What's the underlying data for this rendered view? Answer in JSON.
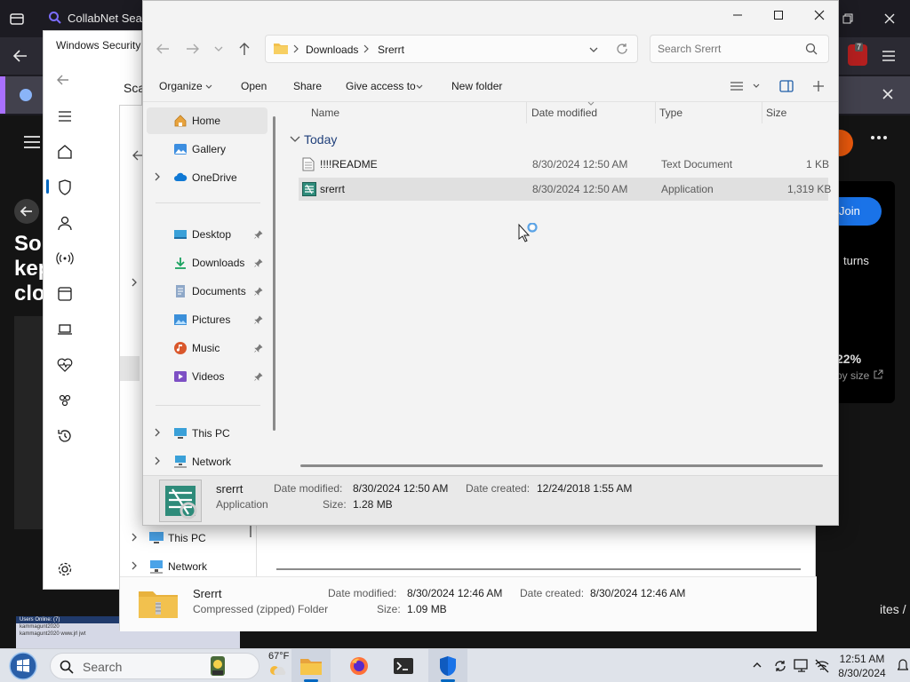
{
  "browser": {
    "tab_title": "CollabNet Sear",
    "badge_count": "7",
    "page_heading_lines": [
      "Sor",
      "kep",
      "clo"
    ],
    "join_label": "Join",
    "side_text_1": "turns",
    "percent_text": "22%",
    "size_text": "py size",
    "footer_text": "ites / apps /",
    "forum_header": "Users Online: (7)",
    "forum_row_1": "kammagunt2020",
    "forum_row_2": "kammagunt2020 www.jrl jwt",
    "forum_row_3": "You may to read the HH function"
  },
  "windows_security": {
    "title": "Windows Security",
    "scan_text": "Sca",
    "nav_icons": [
      "home-icon",
      "shield-icon",
      "account-icon",
      "network-icon",
      "app-browser-icon",
      "device-icon",
      "health-icon",
      "family-icon",
      "history-icon",
      "settings-icon"
    ]
  },
  "explorer_back": {
    "nav_this_pc": "This PC",
    "nav_network": "Network",
    "details": {
      "name": "Srerrt",
      "type": "Compressed (zipped) Folder",
      "date_modified_label": "Date modified:",
      "date_modified": "8/30/2024 12:46 AM",
      "date_created_label": "Date created:",
      "date_created": "8/30/2024 12:46 AM",
      "size_label": "Size:",
      "size": "1.09 MB"
    }
  },
  "explorer": {
    "breadcrumb": [
      "Downloads",
      "Srerrt"
    ],
    "search_placeholder": "Search Srerrt",
    "commands": {
      "organize": "Organize",
      "open": "Open",
      "share": "Share",
      "give_access": "Give access to",
      "new_folder": "New folder"
    },
    "nav": {
      "home": "Home",
      "gallery": "Gallery",
      "onedrive": "OneDrive",
      "desktop": "Desktop",
      "downloads": "Downloads",
      "documents": "Documents",
      "pictures": "Pictures",
      "music": "Music",
      "videos": "Videos",
      "this_pc": "This PC",
      "network": "Network"
    },
    "columns": {
      "name": "Name",
      "date_modified": "Date modified",
      "type": "Type",
      "size": "Size"
    },
    "group_label": "Today",
    "files": [
      {
        "name": "!!!!README",
        "date": "8/30/2024 12:50 AM",
        "type": "Text Document",
        "size": "1 KB",
        "icon": "text-document-icon"
      },
      {
        "name": "srerrt",
        "date": "8/30/2024 12:50 AM",
        "type": "Application",
        "size": "1,319 KB",
        "icon": "application-icon"
      }
    ],
    "details": {
      "name": "srerrt",
      "type": "Application",
      "date_modified_label": "Date modified:",
      "date_modified": "8/30/2024 12:50 AM",
      "date_created_label": "Date created:",
      "date_created": "12/24/2018 1:55 AM",
      "size_label": "Size:",
      "size": "1.28 MB"
    }
  },
  "taskbar": {
    "search_placeholder": "Search",
    "weather": "67°F",
    "time": "12:51 AM",
    "date": "8/30/2024"
  },
  "colors": {
    "accent": "#0067c0",
    "folder_yellow": "#f2c14e",
    "browser_bg": "#1c1b22",
    "join_blue": "#1a73e8",
    "orange_avatar": "#e8580c"
  }
}
